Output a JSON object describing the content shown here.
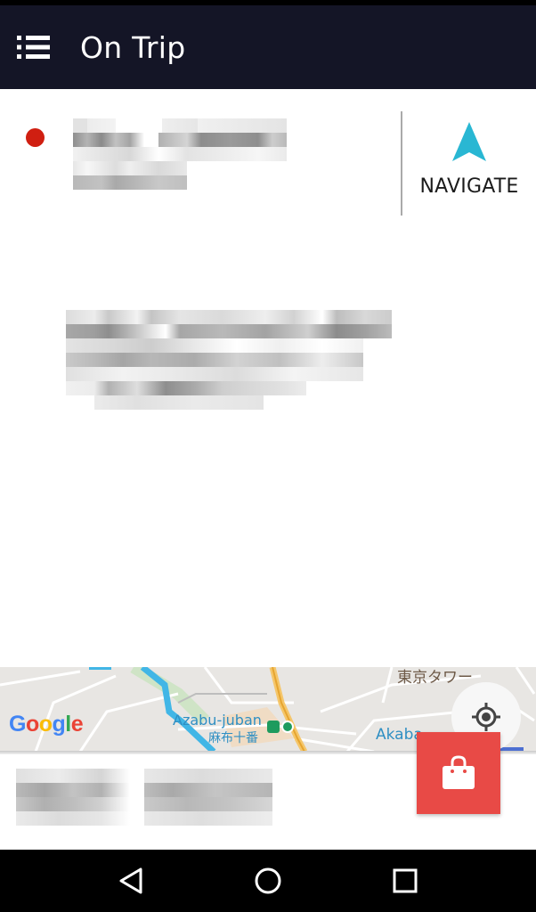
{
  "app_bar": {
    "title": "On Trip",
    "menu_icon": "list-menu-icon",
    "background": "#141526"
  },
  "trip": {
    "destination_dot_color": "#d01f11",
    "navigate": {
      "label": "NAVIGATE",
      "icon": "navigation-arrow-icon",
      "icon_color": "#29b7d3"
    }
  },
  "map": {
    "google_logo": [
      "G",
      "o",
      "o",
      "g",
      "l",
      "e"
    ],
    "google_colors": [
      "#4285f4",
      "#ea4335",
      "#fbbc05",
      "#4285f4",
      "#34a853",
      "#ea4335"
    ],
    "labels": {
      "station_en": "Azabu-juban",
      "station_ja": "麻布十番",
      "area": "Akaba",
      "landmark": "東京タワー"
    },
    "locate_icon": "my-location-icon"
  },
  "fab": {
    "icon": "shopping-bag-icon",
    "color": "#e84a46"
  },
  "system_nav": {
    "back_icon": "back-triangle-icon",
    "home_icon": "home-circle-icon",
    "recents_icon": "recents-square-icon"
  }
}
